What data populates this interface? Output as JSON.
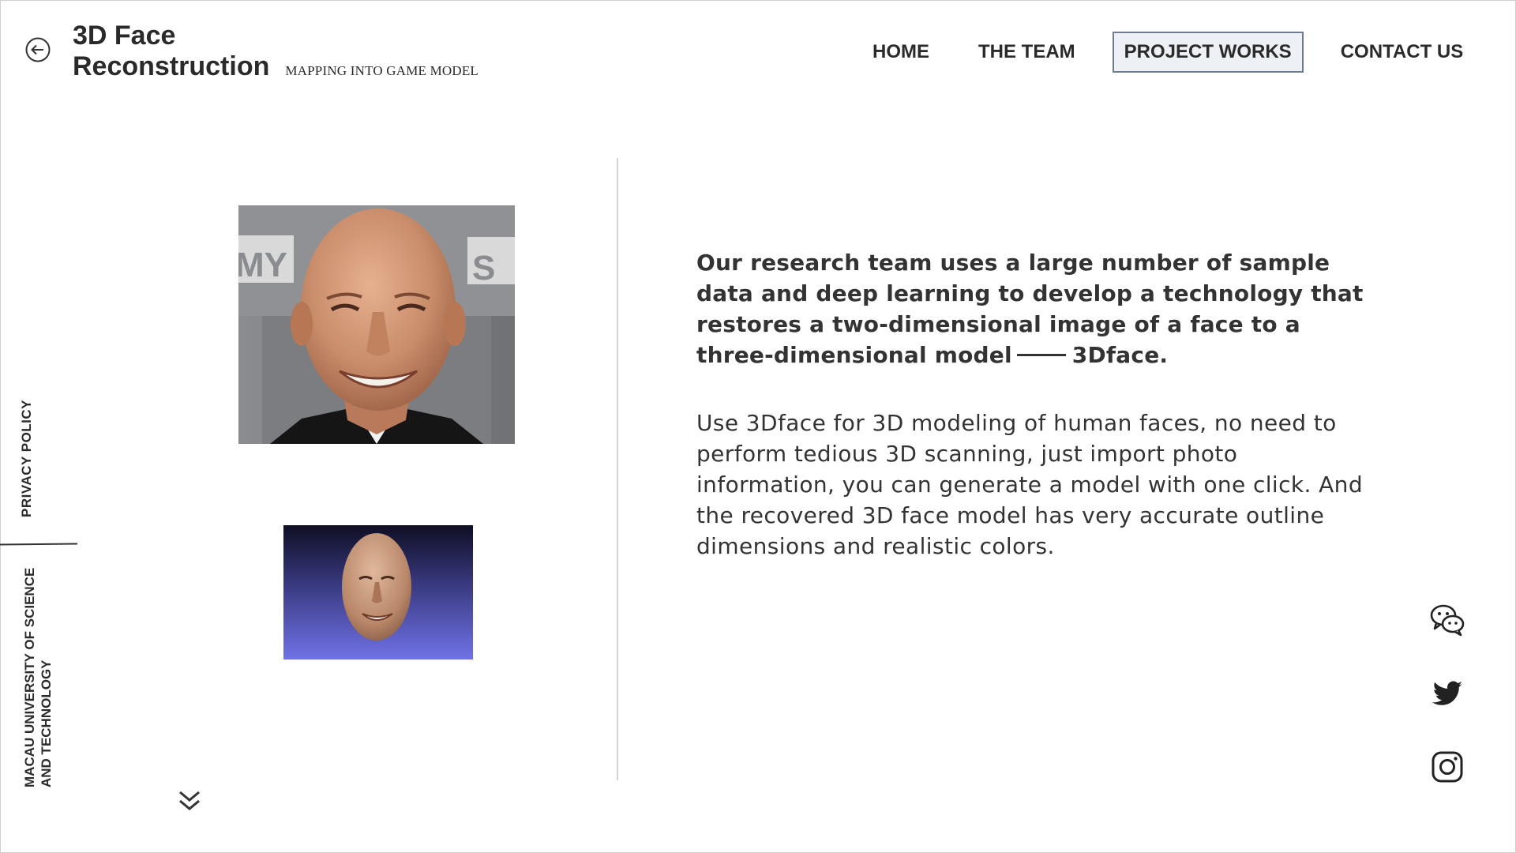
{
  "header": {
    "title_line1": "3D Face",
    "title_line2": "Reconstruction",
    "subtitle": "MAPPING INTO GAME MODEL"
  },
  "nav": {
    "items": [
      {
        "label": "HOME"
      },
      {
        "label": "THE TEAM"
      },
      {
        "label": "PROJECT WORKS",
        "active": true
      },
      {
        "label": "CONTACT US"
      }
    ]
  },
  "sidebar": {
    "privacy": "PRIVACY POLICY",
    "university": "MACAU UNIVERSITY OF SCIENCE AND TECHNOLOGY"
  },
  "content": {
    "intro_part1": "Our research team uses a large number of sample data and deep learning to develop a technology that restores a two-dimensional image of a face to a three-dimensional model",
    "intro_part2": "3Dface.",
    "body": "Use 3Dface for 3D modeling of human faces, no need to perform tedious 3D scanning, just import photo information, you can generate a model with one click. And the recovered 3D face model has very accurate outline dimensions and realistic colors."
  },
  "images": {
    "photo_sign_left": "MY",
    "photo_sign_right": "S"
  },
  "icons": {
    "back": "arrow-left-circle-icon",
    "scroll": "double-chevron-down-icon",
    "social": [
      "wechat-icon",
      "twitter-icon",
      "instagram-icon"
    ]
  },
  "colors": {
    "text": "#2b2b2b",
    "active_nav_bg": "#edf0f4",
    "active_nav_border": "#6d7d8f"
  }
}
